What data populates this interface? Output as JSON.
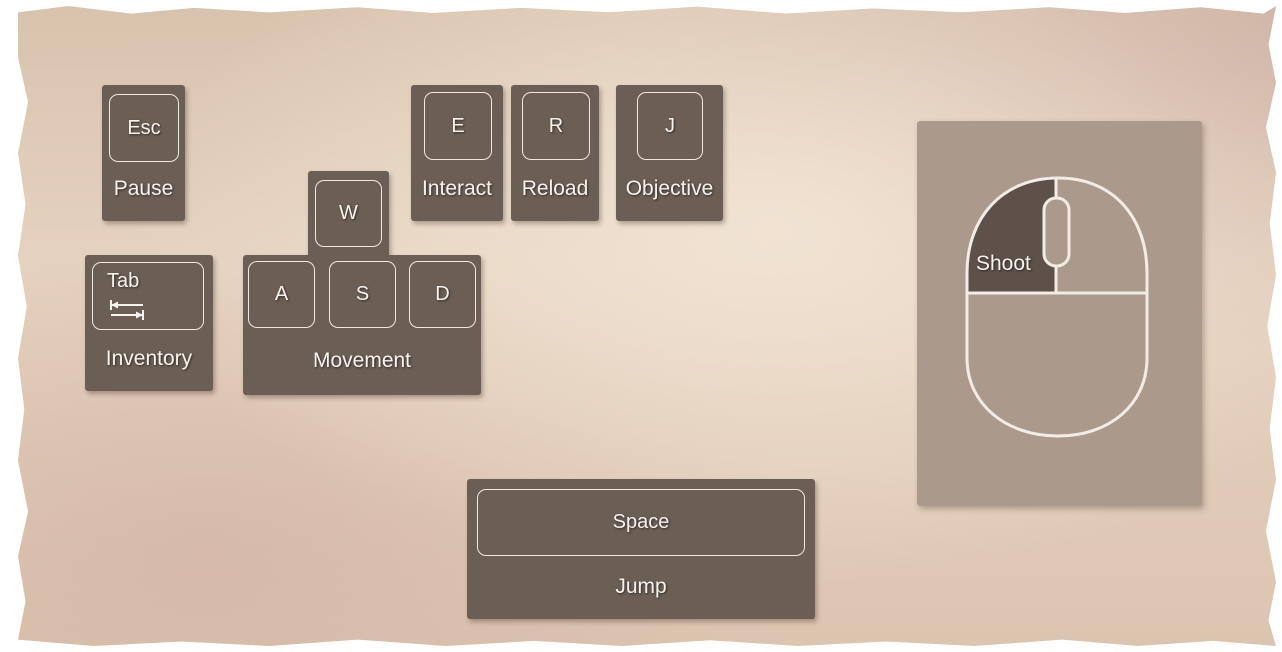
{
  "keys": {
    "esc": {
      "key": "Esc",
      "action": "Pause"
    },
    "tab": {
      "key": "Tab",
      "action": "Inventory"
    },
    "movement": {
      "w": "W",
      "a": "A",
      "s": "S",
      "d": "D",
      "action": "Movement"
    },
    "e": {
      "key": "E",
      "action": "Interact"
    },
    "r": {
      "key": "R",
      "action": "Reload"
    },
    "j": {
      "key": "J",
      "action": "Objective"
    },
    "space": {
      "key": "Space",
      "action": "Jump"
    }
  },
  "mouse": {
    "left_button_action": "Shoot"
  },
  "icons": {
    "tab": "tab-arrows-icon",
    "mouse": "mouse-icon"
  },
  "colors": {
    "key_background": "#6b5f55",
    "key_border": "#efe8e2",
    "mouse_panel": "#ab9a8b",
    "mouse_highlight": "#5e514a",
    "paper": "#e0ccb8"
  }
}
